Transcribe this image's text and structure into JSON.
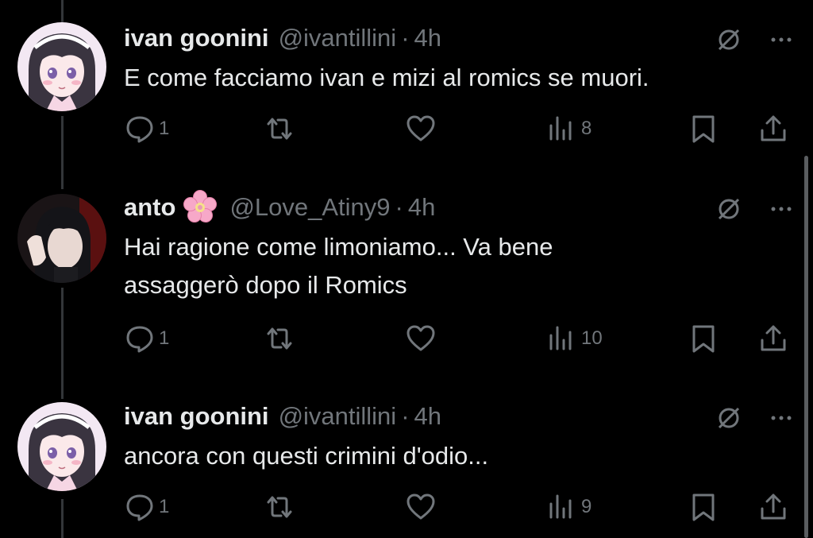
{
  "tweets": [
    {
      "name": "ivan goonini",
      "emoji": "",
      "handle": "@ivantillini",
      "time": "4h",
      "lines": [
        "E come facciamo ivan e mizi al romics se muori."
      ],
      "replies": "1",
      "views": "8",
      "avatar": "anime-girl-avatar"
    },
    {
      "name": "anto",
      "emoji": "cherry-blossom",
      "handle": "@Love_Atiny9",
      "time": "4h",
      "lines": [
        "Hai ragione come limoniamo... Va bene",
        "assaggerò dopo il Romics"
      ],
      "replies": "1",
      "views": "10",
      "avatar": "photo-avatar"
    },
    {
      "name": "ivan goonini",
      "emoji": "",
      "handle": "@ivantillini",
      "time": "4h",
      "lines": [
        "ancora con questi crimini d'odio..."
      ],
      "replies": "1",
      "views": "9",
      "avatar": "anime-girl-avatar"
    }
  ],
  "separator": "·",
  "colors": {
    "background": "#000000",
    "text": "#e7e9ea",
    "muted": "#71767b",
    "thread_line": "#333639"
  }
}
